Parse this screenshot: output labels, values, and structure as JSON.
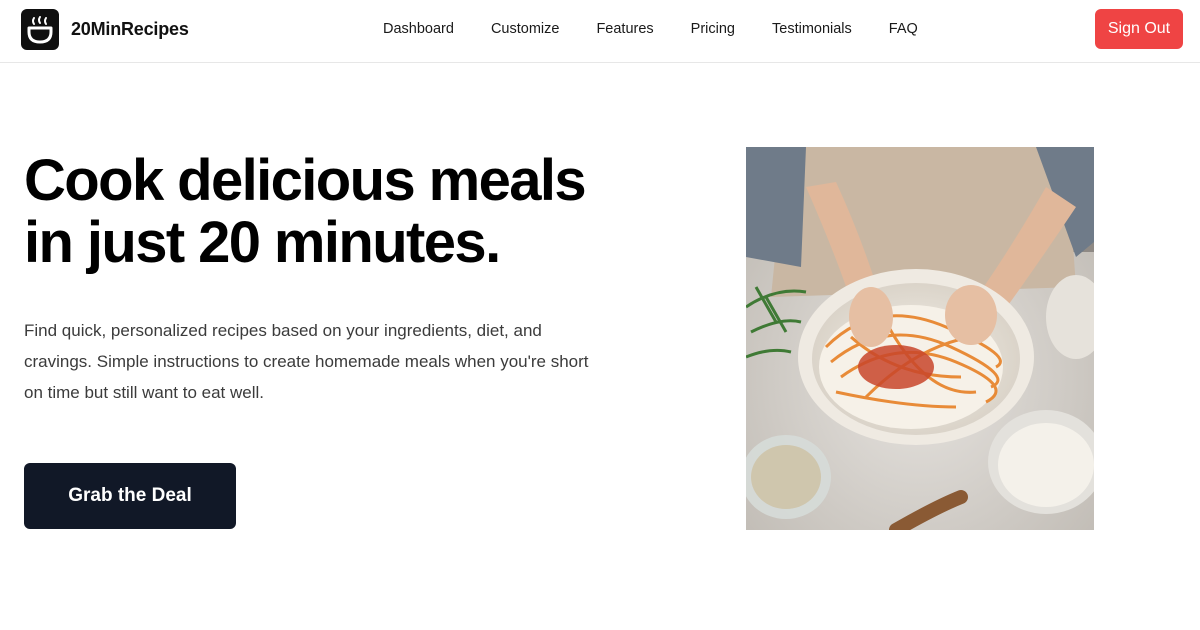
{
  "brand": {
    "name": "20MinRecipes",
    "logo_icon": "cooking-pot-icon"
  },
  "nav": {
    "items": [
      "Dashboard",
      "Customize",
      "Features",
      "Pricing",
      "Testimonials",
      "FAQ"
    ]
  },
  "header": {
    "signout_label": "Sign Out",
    "signout_color": "#ef4444"
  },
  "hero": {
    "headline_line1": "Cook delicious meals",
    "headline_line2": "in just 20 minutes.",
    "description": "Find quick, personalized recipes based on your ingredients, diet, and cravings. Simple instructions to create homemade meals when you're short on time but still want to eat well.",
    "cta_label": "Grab the Deal",
    "cta_color": "#111827",
    "image_subject": "hands mixing spaghetti with sauce and cheese in a bowl"
  }
}
